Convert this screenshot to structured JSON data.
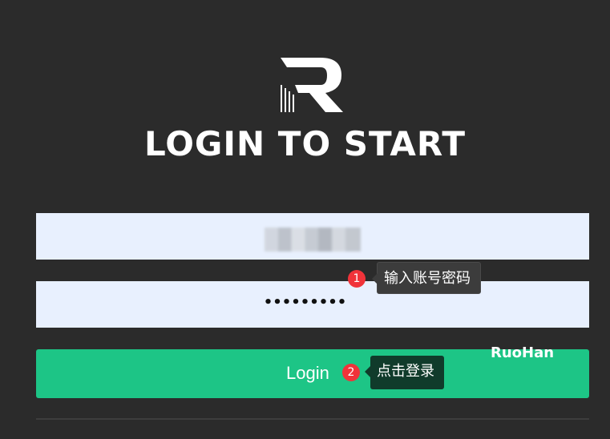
{
  "header": {
    "title": "LOGIN TO START",
    "logo_icon": "r-logo-icon"
  },
  "form": {
    "username_value": "",
    "password_value": "•••••••••",
    "login_label": "Login"
  },
  "annotations": [
    {
      "number": "1",
      "text": "输入账号密码"
    },
    {
      "number": "2",
      "text": "点击登录"
    }
  ],
  "watermark": "RuoHan",
  "colors": {
    "background": "#2b2b2b",
    "input_bg": "#e8f0fe",
    "button": "#1dc586",
    "badge": "#f0333a"
  }
}
